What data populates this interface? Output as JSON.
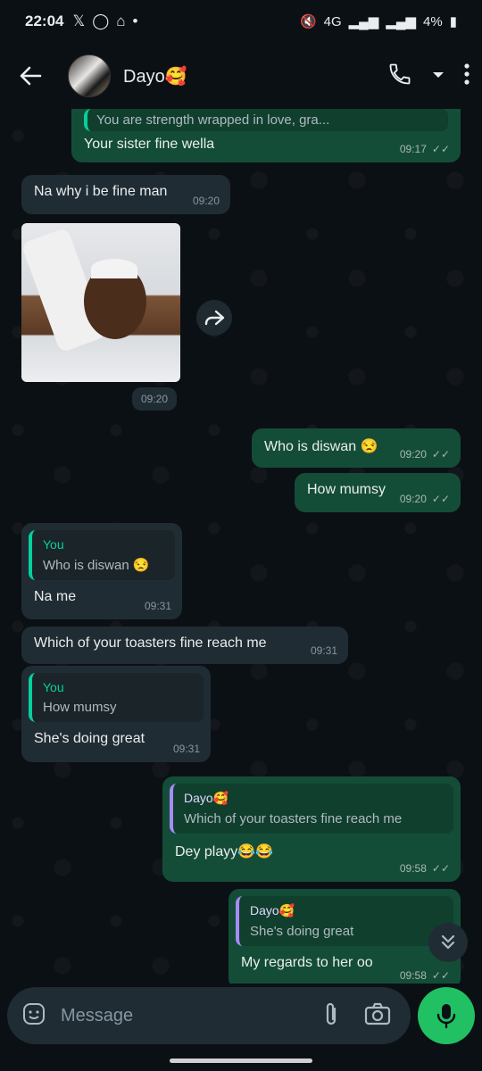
{
  "status_bar": {
    "time": "22:04",
    "network": "4G",
    "battery": "4%"
  },
  "header": {
    "contact_name": "Dayo🥰"
  },
  "messages": [
    {
      "id": "m1",
      "direction": "out",
      "quote_text": "You are strength wrapped in love, gra...",
      "text": "Your sister fine wella",
      "time": "09:17",
      "ticks": "✓✓"
    },
    {
      "id": "m2",
      "direction": "in",
      "text": "Na why i be fine man",
      "time": "09:20"
    },
    {
      "id": "m3",
      "direction": "in",
      "type": "image",
      "time": "09:20"
    },
    {
      "id": "m4",
      "direction": "out",
      "text": "Who is diswan 😒",
      "time": "09:20",
      "ticks": "✓✓"
    },
    {
      "id": "m5",
      "direction": "out",
      "text": "How mumsy",
      "time": "09:20",
      "ticks": "✓✓"
    },
    {
      "id": "m6",
      "direction": "in",
      "quote_name": "You",
      "quote_text": "Who is diswan 😒",
      "text": "Na me",
      "time": "09:31"
    },
    {
      "id": "m7",
      "direction": "in",
      "text": "Which of your toasters fine reach me",
      "time": "09:31"
    },
    {
      "id": "m8",
      "direction": "in",
      "quote_name": "You",
      "quote_text": "How mumsy",
      "text": "She's doing great",
      "time": "09:31"
    },
    {
      "id": "m9",
      "direction": "out",
      "quote_name": "Dayo🥰",
      "quote_text": "Which of your toasters fine reach me",
      "text": "Dey playy😂😂",
      "time": "09:58",
      "ticks": "✓✓"
    },
    {
      "id": "m10",
      "direction": "out",
      "quote_name": "Dayo🥰",
      "quote_text": "She's doing great",
      "text": "My regards to her oo",
      "time": "09:58",
      "ticks": "✓✓"
    }
  ],
  "composer": {
    "placeholder": "Message"
  },
  "colors": {
    "background": "#0b1014",
    "incoming": "#202c33",
    "outgoing": "#144d37",
    "accent": "#21c063"
  },
  "icons": [
    "back-arrow-icon",
    "call-icon",
    "dropdown-icon",
    "more-icon",
    "forward-icon",
    "scroll-down-icon",
    "sticker-icon",
    "attach-icon",
    "camera-icon",
    "mic-icon"
  ]
}
